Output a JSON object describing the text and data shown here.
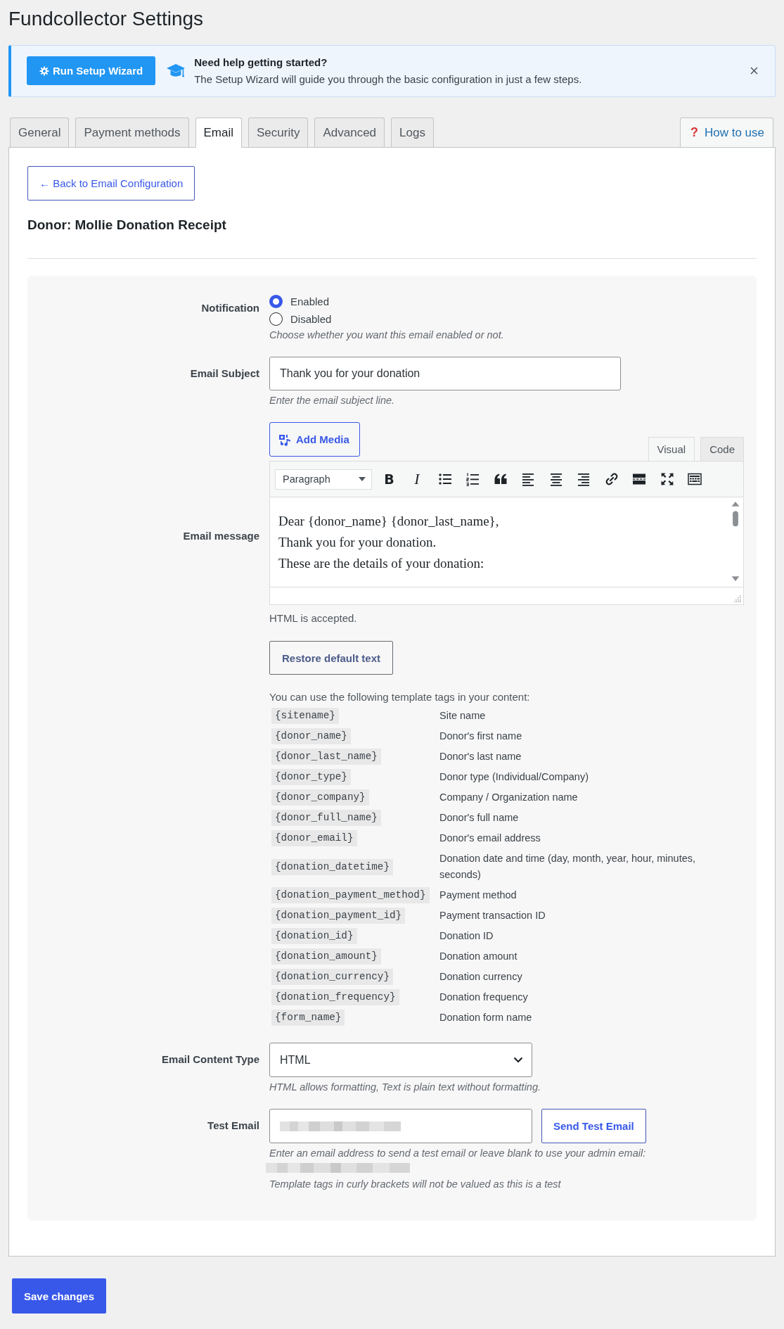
{
  "page_title": "Fundcollector Settings",
  "notice": {
    "button": "Run Setup Wizard",
    "heading": "Need help getting started?",
    "text": "The Setup Wizard will guide you through the basic configuration in just a few steps.",
    "dismissible": true
  },
  "tabs": [
    {
      "label": "General",
      "selected": false
    },
    {
      "label": "Payment methods",
      "selected": false
    },
    {
      "label": "Email",
      "selected": true
    },
    {
      "label": "Security",
      "selected": false
    },
    {
      "label": "Advanced",
      "selected": false
    },
    {
      "label": "Logs",
      "selected": false
    }
  ],
  "help_tab": {
    "icon": "?",
    "label": "How to use"
  },
  "back_button": "← Back to Email Configuration",
  "section_title": "Donor: Mollie Donation Receipt",
  "form": {
    "notification": {
      "label": "Notification",
      "options": [
        {
          "label": "Enabled",
          "selected": true
        },
        {
          "label": "Disabled",
          "selected": false
        }
      ],
      "description": "Choose whether you want this email enabled or not."
    },
    "subject": {
      "label": "Email Subject",
      "value": "Thank you for your donation",
      "description": "Enter the email subject line."
    },
    "message": {
      "label": "Email message",
      "add_media": "Add Media",
      "modes": [
        {
          "label": "Visual",
          "selected": true
        },
        {
          "label": "Code",
          "selected": false
        }
      ],
      "format": "Paragraph",
      "toolbar": [
        {
          "kind": "bold",
          "label": "B"
        },
        {
          "kind": "italic",
          "label": "I"
        },
        {
          "kind": "bulleted-list"
        },
        {
          "kind": "numbered-list"
        },
        {
          "kind": "blockquote"
        },
        {
          "kind": "align-left"
        },
        {
          "kind": "align-center"
        },
        {
          "kind": "align-right"
        },
        {
          "kind": "link"
        },
        {
          "kind": "read-more"
        },
        {
          "kind": "fullscreen"
        },
        {
          "kind": "toolbar-toggle"
        }
      ],
      "content_lines": [
        "Dear {donor_name} {donor_last_name},",
        "Thank you for your donation.",
        "These are the details of your donation:"
      ],
      "note": "HTML is accepted.",
      "restore_button": "Restore default text",
      "tags_intro": "You can use the following template tags in your content:",
      "tags": [
        {
          "tag": "{sitename}",
          "description": "Site name"
        },
        {
          "tag": "{donor_name}",
          "description": "Donor's first name"
        },
        {
          "tag": "{donor_last_name}",
          "description": "Donor's last name"
        },
        {
          "tag": "{donor_type}",
          "description": "Donor type (Individual/Company)"
        },
        {
          "tag": "{donor_company}",
          "description": "Company / Organization name"
        },
        {
          "tag": "{donor_full_name}",
          "description": "Donor's full name"
        },
        {
          "tag": "{donor_email}",
          "description": "Donor's email address"
        },
        {
          "tag": "{donation_datetime}",
          "description": "Donation date and time (day, month, year, hour, minutes, seconds)"
        },
        {
          "tag": "{donation_payment_method}",
          "description": "Payment method"
        },
        {
          "tag": "{donation_payment_id}",
          "description": "Payment transaction ID"
        },
        {
          "tag": "{donation_id}",
          "description": "Donation ID"
        },
        {
          "tag": "{donation_amount}",
          "description": "Donation amount"
        },
        {
          "tag": "{donation_currency}",
          "description": "Donation currency"
        },
        {
          "tag": "{donation_frequency}",
          "description": "Donation frequency"
        },
        {
          "tag": "{form_name}",
          "description": "Donation form name"
        }
      ]
    },
    "content_type": {
      "label": "Email Content Type",
      "value": "HTML",
      "description": "HTML allows formatting, Text is plain text without formatting."
    },
    "test_email": {
      "label": "Test Email",
      "value_redacted": true,
      "button": "Send Test Email",
      "description": "Enter an email address to send a test email or leave blank to use your admin email:",
      "admin_email_redacted": true,
      "note": "Template tags in curly brackets will not be valued as this is a test"
    }
  },
  "save_button": "Save changes"
}
